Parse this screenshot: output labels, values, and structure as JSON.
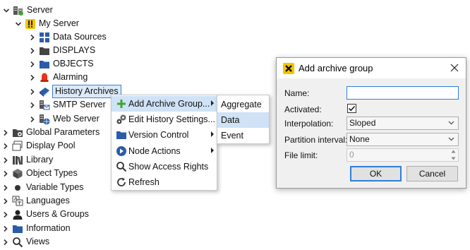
{
  "tree": {
    "items": [
      {
        "label": "Server",
        "icon": "server-group-icon"
      },
      {
        "label": "My Server",
        "icon": "server-alert-icon"
      },
      {
        "label": "Data Sources",
        "icon": "data-sources-icon"
      },
      {
        "label": "DISPLAYS",
        "icon": "folder-dark-icon"
      },
      {
        "label": "OBJECTS",
        "icon": "folder-blue-icon"
      },
      {
        "label": "Alarming",
        "icon": "alarm-bell-icon"
      },
      {
        "label": "History Archives",
        "icon": "history-archive-icon"
      },
      {
        "label": "SMTP Server",
        "icon": "smtp-server-icon"
      },
      {
        "label": "Web Server",
        "icon": "web-server-icon"
      },
      {
        "label": "Global Parameters",
        "icon": "global-parameters-icon"
      },
      {
        "label": "Display Pool",
        "icon": "display-pool-icon"
      },
      {
        "label": "Library",
        "icon": "library-icon"
      },
      {
        "label": "Object Types",
        "icon": "object-types-icon"
      },
      {
        "label": "Variable Types",
        "icon": "variable-types-icon"
      },
      {
        "label": "Languages",
        "icon": "languages-icon"
      },
      {
        "label": "Users & Groups",
        "icon": "users-groups-icon"
      },
      {
        "label": "Information",
        "icon": "folder-blue-icon"
      },
      {
        "label": "Views",
        "icon": "views-search-icon"
      }
    ]
  },
  "context_menu": {
    "items": [
      {
        "label": "Add Archive Group...",
        "icon": "plus-green-icon",
        "has_submenu": true
      },
      {
        "label": "Edit History Settings...",
        "icon": "gears-icon",
        "has_submenu": false
      },
      {
        "label": "Version Control",
        "icon": "folder-blue-icon",
        "has_submenu": true
      },
      {
        "label": "Node Actions",
        "icon": "node-actions-icon",
        "has_submenu": true
      },
      {
        "label": "Show Access Rights",
        "icon": "search-icon",
        "has_submenu": false
      },
      {
        "label": "Refresh",
        "icon": "refresh-icon",
        "has_submenu": false
      }
    ]
  },
  "submenu": {
    "items": [
      {
        "label": "Aggregate"
      },
      {
        "label": "Data"
      },
      {
        "label": "Event"
      }
    ],
    "highlighted": "Data"
  },
  "dialog": {
    "title": "Add archive group",
    "name_label": "Name:",
    "name_value": "",
    "activated_label": "Activated:",
    "activated_checked": true,
    "interpolation_label": "Interpolation:",
    "interpolation_value": "Sloped",
    "partition_label": "Partition interval:",
    "partition_value": "None",
    "file_limit_label": "File limit:",
    "file_limit_value": "0",
    "ok_label": "OK",
    "cancel_label": "Cancel"
  },
  "colors": {
    "selection_border": "#3d7bd9",
    "menu_highlight": "#cfe2f6",
    "folder_blue": "#2a5caa",
    "plus_green": "#3fa535",
    "alarm_red": "#e8341c",
    "app_yellow": "#f5c400"
  }
}
